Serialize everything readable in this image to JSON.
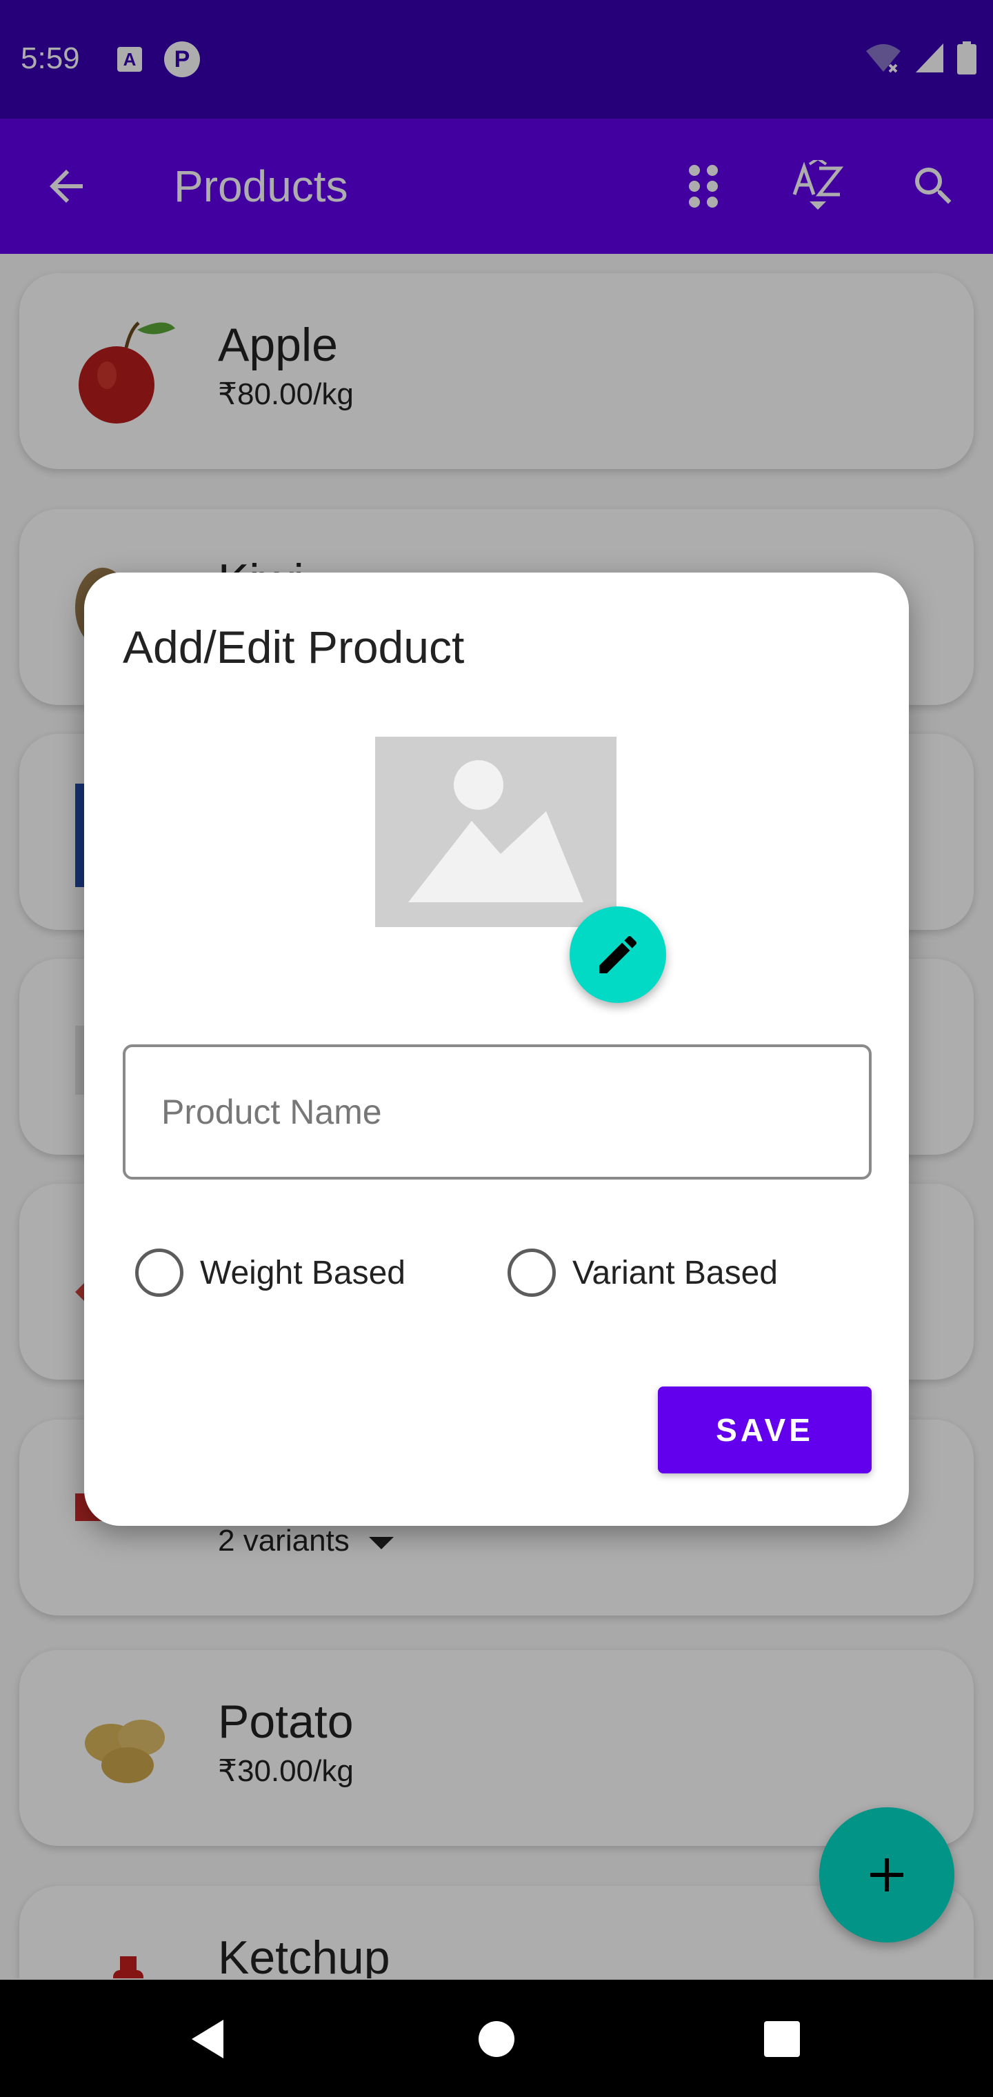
{
  "status_bar": {
    "time": "5:59",
    "notif_a": "A",
    "notif_p": "P",
    "icons": [
      "wifi-off-icon",
      "signal-icon",
      "battery-icon"
    ]
  },
  "app_bar": {
    "title": "Products",
    "icons": [
      "back-arrow-icon",
      "grid-dots-icon",
      "sort-az-icon",
      "search-icon"
    ]
  },
  "products": [
    {
      "name": "Apple",
      "detail": "₹80.00/kg",
      "icon": "apple-image"
    },
    {
      "name": "Kiwi",
      "detail": "",
      "icon": "kiwi-image"
    },
    {
      "name": "",
      "detail": "",
      "icon": "packet-image"
    },
    {
      "name": "",
      "detail": "",
      "icon": "product-image"
    },
    {
      "name": "",
      "detail": "",
      "icon": "watermelon-image"
    },
    {
      "name": "",
      "detail": "2 variants",
      "icon": "toothpaste-image"
    },
    {
      "name": "Potato",
      "detail": "₹30.00/kg",
      "icon": "potato-image"
    },
    {
      "name": "Ketchup",
      "detail": "",
      "icon": "ketchup-image"
    }
  ],
  "dialog": {
    "title": "Add/Edit Product",
    "image_icon": "image-placeholder-icon",
    "edit_icon": "pencil-icon",
    "name_placeholder": "Product Name",
    "name_value": "",
    "radio_weight": "Weight Based",
    "radio_variant": "Variant Based",
    "save_label": "SAVE"
  },
  "fab_icon": "plus-icon",
  "colors": {
    "status_bar": "#3700b3",
    "primary": "#6200ee",
    "accent": "#03dac5"
  }
}
